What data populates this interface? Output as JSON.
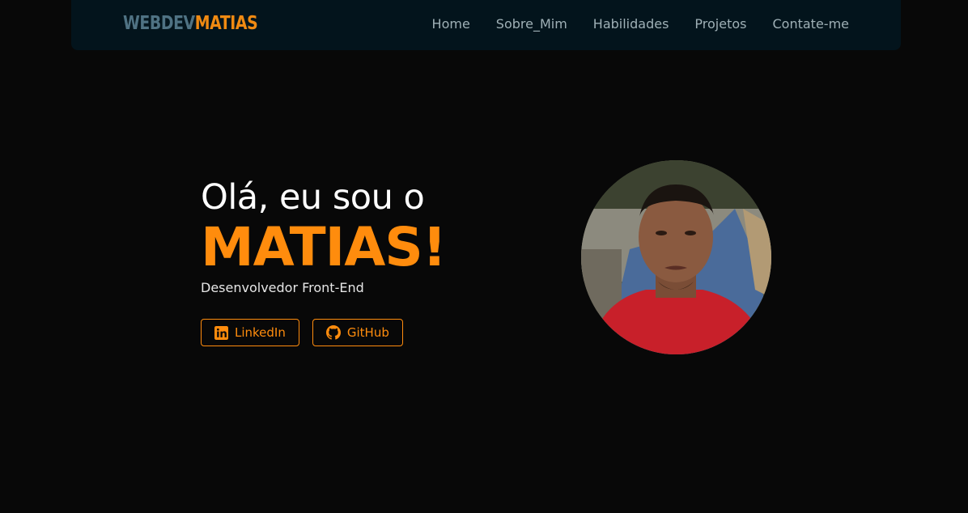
{
  "navbar": {
    "logo_part1": "WEBDEV",
    "logo_part2": "MATIAS",
    "links": [
      "Home",
      "Sobre_Mim",
      "Habilidades",
      "Projetos",
      "Contate-me"
    ]
  },
  "hero": {
    "greeting": "Olá, eu sou o",
    "name": "MATIAS!",
    "role": "Desenvolvedor Front-End",
    "buttons": {
      "linkedin": "LinkedIn",
      "github": "GitHub"
    }
  },
  "icons": {
    "linkedin": "linkedin-icon",
    "github": "github-icon"
  },
  "colors": {
    "accent": "#ff8c0d",
    "logo_primary": "#4f7283",
    "nav_bg": "#03141c",
    "page_bg": "#080808"
  }
}
